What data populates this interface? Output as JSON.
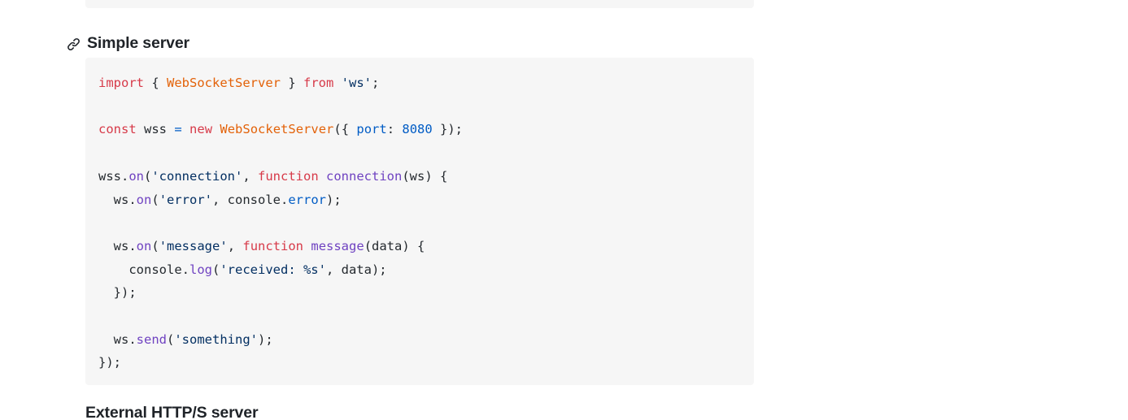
{
  "theme": {
    "page_background": "#ffffff",
    "code_background": "#f6f6f6",
    "text_color": "#24292e",
    "heading_color": "#1f2328",
    "keyword_color": "#d73a49",
    "class_color": "#e36209",
    "string_color": "#032f62",
    "number_color": "#005cc5",
    "method_color": "#6f42c1"
  },
  "section": {
    "anchor_icon": "link-icon",
    "heading": "Simple server"
  },
  "code_block": {
    "language": "javascript",
    "lines": [
      {
        "index": 1,
        "text": "import { WebSocketServer } from 'ws';",
        "tokens": [
          {
            "t": "import",
            "c": "tok-keyword"
          },
          {
            "t": " { ",
            "c": "tok-plain"
          },
          {
            "t": "WebSocketServer",
            "c": "tok-class"
          },
          {
            "t": " } ",
            "c": "tok-plain"
          },
          {
            "t": "from",
            "c": "tok-keyword"
          },
          {
            "t": " ",
            "c": "tok-plain"
          },
          {
            "t": "'ws'",
            "c": "tok-string"
          },
          {
            "t": ";",
            "c": "tok-plain"
          }
        ]
      },
      {
        "index": 2,
        "text": "",
        "tokens": []
      },
      {
        "index": 3,
        "text": "const wss = new WebSocketServer({ port: 8080 });",
        "tokens": [
          {
            "t": "const",
            "c": "tok-keyword"
          },
          {
            "t": " wss ",
            "c": "tok-plain"
          },
          {
            "t": "=",
            "c": "tok-op"
          },
          {
            "t": " ",
            "c": "tok-plain"
          },
          {
            "t": "new",
            "c": "tok-keyword"
          },
          {
            "t": " ",
            "c": "tok-plain"
          },
          {
            "t": "WebSocketServer",
            "c": "tok-class"
          },
          {
            "t": "({ ",
            "c": "tok-plain"
          },
          {
            "t": "port",
            "c": "tok-prop"
          },
          {
            "t": ": ",
            "c": "tok-plain"
          },
          {
            "t": "8080",
            "c": "tok-number"
          },
          {
            "t": " });",
            "c": "tok-plain"
          }
        ]
      },
      {
        "index": 4,
        "text": "",
        "tokens": []
      },
      {
        "index": 5,
        "text": "wss.on('connection', function connection(ws) {",
        "tokens": [
          {
            "t": "wss.",
            "c": "tok-plain"
          },
          {
            "t": "on",
            "c": "tok-method"
          },
          {
            "t": "(",
            "c": "tok-plain"
          },
          {
            "t": "'connection'",
            "c": "tok-string"
          },
          {
            "t": ", ",
            "c": "tok-plain"
          },
          {
            "t": "function",
            "c": "tok-keyword"
          },
          {
            "t": " ",
            "c": "tok-plain"
          },
          {
            "t": "connection",
            "c": "tok-func"
          },
          {
            "t": "(ws) {",
            "c": "tok-plain"
          }
        ]
      },
      {
        "index": 6,
        "text": "  ws.on('error', console.error);",
        "tokens": [
          {
            "t": "  ws.",
            "c": "tok-plain"
          },
          {
            "t": "on",
            "c": "tok-method"
          },
          {
            "t": "(",
            "c": "tok-plain"
          },
          {
            "t": "'error'",
            "c": "tok-string"
          },
          {
            "t": ", console.",
            "c": "tok-plain"
          },
          {
            "t": "error",
            "c": "tok-number"
          },
          {
            "t": ");",
            "c": "tok-plain"
          }
        ]
      },
      {
        "index": 7,
        "text": "",
        "tokens": []
      },
      {
        "index": 8,
        "text": "  ws.on('message', function message(data) {",
        "tokens": [
          {
            "t": "  ws.",
            "c": "tok-plain"
          },
          {
            "t": "on",
            "c": "tok-method"
          },
          {
            "t": "(",
            "c": "tok-plain"
          },
          {
            "t": "'message'",
            "c": "tok-string"
          },
          {
            "t": ", ",
            "c": "tok-plain"
          },
          {
            "t": "function",
            "c": "tok-keyword"
          },
          {
            "t": " ",
            "c": "tok-plain"
          },
          {
            "t": "message",
            "c": "tok-func"
          },
          {
            "t": "(data) {",
            "c": "tok-plain"
          }
        ]
      },
      {
        "index": 9,
        "text": "    console.log('received: %s', data);",
        "tokens": [
          {
            "t": "    console.",
            "c": "tok-plain"
          },
          {
            "t": "log",
            "c": "tok-method"
          },
          {
            "t": "(",
            "c": "tok-plain"
          },
          {
            "t": "'received: %s'",
            "c": "tok-string"
          },
          {
            "t": ", data);",
            "c": "tok-plain"
          }
        ]
      },
      {
        "index": 10,
        "text": "  });",
        "tokens": [
          {
            "t": "  });",
            "c": "tok-plain"
          }
        ]
      },
      {
        "index": 11,
        "text": "",
        "tokens": []
      },
      {
        "index": 12,
        "text": "  ws.send('something');",
        "tokens": [
          {
            "t": "  ws.",
            "c": "tok-plain"
          },
          {
            "t": "send",
            "c": "tok-method"
          },
          {
            "t": "(",
            "c": "tok-plain"
          },
          {
            "t": "'something'",
            "c": "tok-string"
          },
          {
            "t": ");",
            "c": "tok-plain"
          }
        ]
      },
      {
        "index": 13,
        "text": "});",
        "tokens": [
          {
            "t": "});",
            "c": "tok-plain"
          }
        ]
      }
    ]
  },
  "next_section": {
    "heading": "External HTTP/S server"
  }
}
